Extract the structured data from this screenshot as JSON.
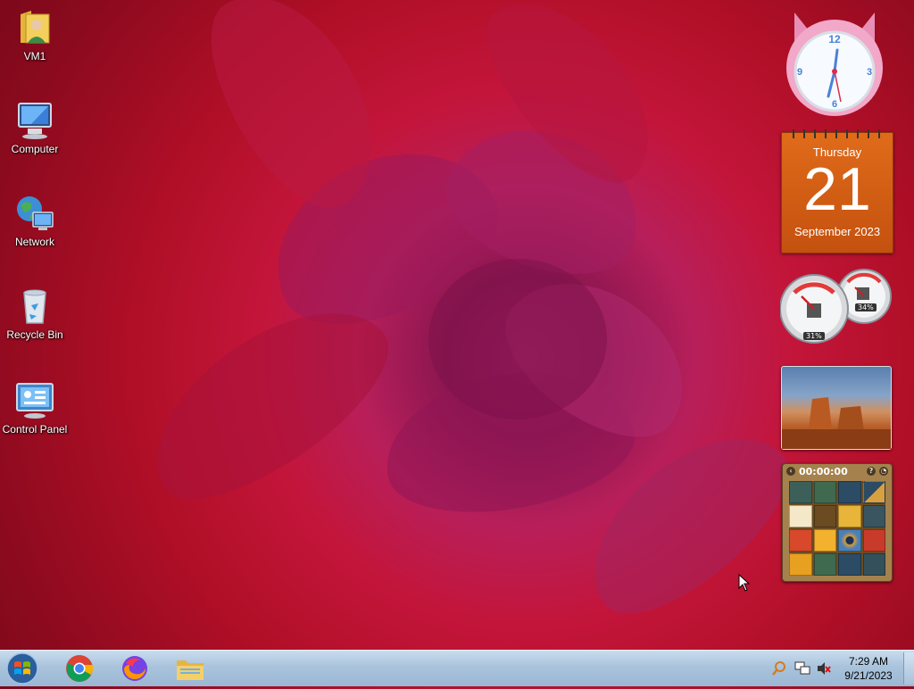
{
  "desktop_icons": [
    {
      "label": "VM1",
      "icon": "user-folder-icon"
    },
    {
      "label": "Computer",
      "icon": "computer-icon"
    },
    {
      "label": "Network",
      "icon": "network-icon"
    },
    {
      "label": "Recycle Bin",
      "icon": "recycle-bin-icon"
    },
    {
      "label": "Control Panel",
      "icon": "control-panel-icon"
    }
  ],
  "gadgets": {
    "calendar": {
      "day_name": "Thursday",
      "date": "21",
      "month_year": "September 2023"
    },
    "meters": {
      "cpu": "31%",
      "ram": "34%"
    },
    "puzzle": {
      "timer": "00:00:00"
    }
  },
  "taskbar": {
    "pinned": [
      {
        "name": "chrome-button",
        "icon": "chrome-icon"
      },
      {
        "name": "firefox-button",
        "icon": "firefox-icon"
      },
      {
        "name": "explorer-button",
        "icon": "folder-icon"
      }
    ],
    "clock_time": "7:29 AM",
    "clock_date": "9/21/2023"
  },
  "colors": {
    "wallpaper_primary": "#c3153a",
    "calendar_orange": "#d25d14",
    "taskbar": "#a9c3dc"
  }
}
